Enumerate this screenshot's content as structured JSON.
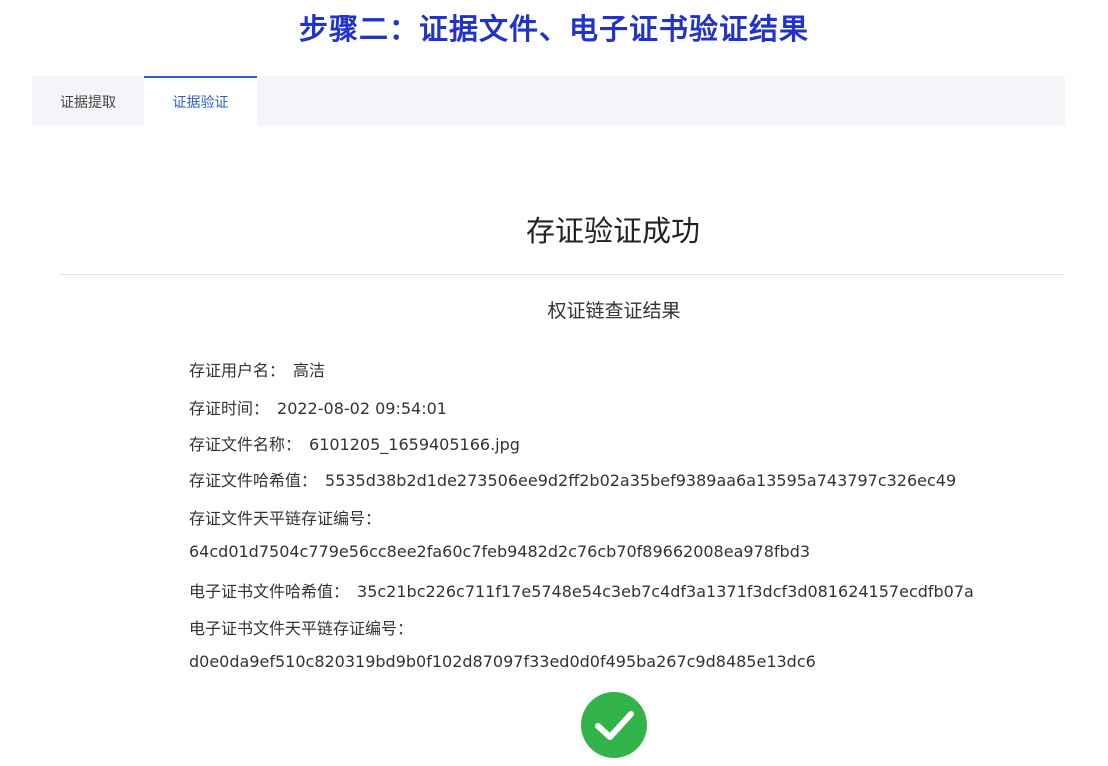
{
  "heading": "步骤二：证据文件、电子证书验证结果",
  "tabs": [
    {
      "label": "证据提取",
      "active": false
    },
    {
      "label": "证据验证",
      "active": true
    }
  ],
  "result": {
    "title": "存证验证成功",
    "subtitle": "权证链查证结果"
  },
  "details": {
    "username_label": "存证用户名：",
    "username": "高洁",
    "time_label": "存证时间：",
    "time": "2022-08-02 09:54:01",
    "filename_label": "存证文件名称：",
    "filename": "6101205_1659405166.jpg",
    "hash_label": "存证文件哈希值：",
    "hash": "5535d38b2d1de273506ee9d2ff2b02a35bef9389aa6a13595a743797c326ec49",
    "chain_no_label": "存证文件天平链存证编号：",
    "chain_no": "64cd01d7504c779e56cc8ee2fa60c7feb9482d2c76cb70f89662008ea978fbd3",
    "cert_hash_label": "电子证书文件哈希值：",
    "cert_hash": "35c21bc226c711f17e5748e54c3eb7c4df3a1371f3dcf3d081624157ecdfb07a",
    "cert_chain_no_label": "电子证书文件天平链存证编号：",
    "cert_chain_no": "d0e0da9ef510c820319bd9b0f102d87097f33ed0d0f495ba267c9d8485e13dc6"
  },
  "status_icon": "success-check-icon",
  "colors": {
    "heading": "#2233cc",
    "active_tab": "#2a63c8",
    "success": "#32b34a"
  }
}
